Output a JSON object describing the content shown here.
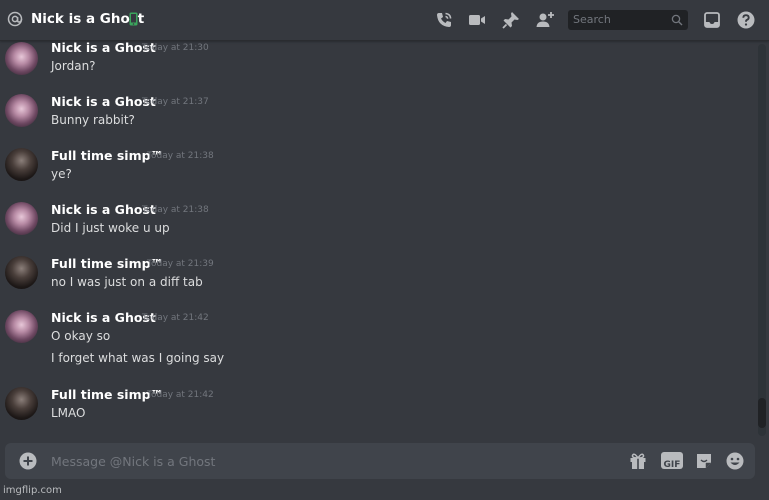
{
  "header": {
    "channel_name": "Nick is a Ghost",
    "search_placeholder": "Search",
    "icons": [
      "at-icon",
      "mobile-icon",
      "call-icon",
      "video-icon",
      "pin-icon",
      "add-member-icon",
      "search-icon",
      "inbox-icon",
      "help-icon"
    ]
  },
  "messages": [
    {
      "author": "Nick is a Ghost",
      "time": "Today at 21:30",
      "lines": [
        "Jordan?"
      ]
    },
    {
      "author": "Nick is a Ghost",
      "time": "Today at 21:37",
      "lines": [
        "Bunny rabbit?"
      ]
    },
    {
      "author": "Full time simp™",
      "time": "Today at 21:38",
      "lines": [
        "ye?"
      ]
    },
    {
      "author": "Nick is a Ghost",
      "time": "Today at 21:38",
      "lines": [
        "Did I just woke u up"
      ]
    },
    {
      "author": "Full time simp™",
      "time": "Today at 21:39",
      "lines": [
        "no I was just on a diff tab"
      ]
    },
    {
      "author": "Nick is a Ghost",
      "time": "Today at 21:42",
      "lines": [
        "O okay so",
        "I forget what was I going say"
      ]
    },
    {
      "author": "Full time simp™",
      "time": "Today at 21:42",
      "lines": [
        "LMAO"
      ]
    }
  ],
  "composer": {
    "placeholder": "Message @Nick is a Ghost",
    "gif_label": "GIF",
    "icons": [
      "add-icon",
      "gift-icon",
      "gif-icon",
      "sticker-icon",
      "emoji-icon"
    ]
  },
  "watermark": "imgflip.com",
  "colors": {
    "background": "#36393f",
    "input_background": "#40444b",
    "search_background": "#202225",
    "online_green": "#3ba55d",
    "author_text": "#ffffff",
    "timestamp": "#72767d"
  }
}
